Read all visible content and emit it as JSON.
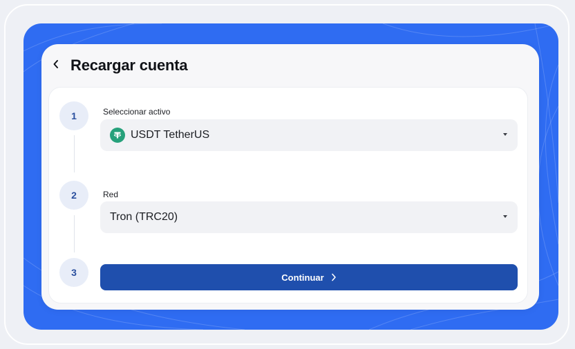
{
  "header": {
    "title": "Recargar cuenta",
    "back_icon": "chevron-left-icon"
  },
  "steps": [
    {
      "number": "1",
      "label": "Seleccionar activo",
      "value": "USDT TetherUS",
      "icon": "tether-icon"
    },
    {
      "number": "2",
      "label": "Red",
      "value": "Tron (TRC20)"
    },
    {
      "number": "3"
    }
  ],
  "actions": {
    "continue_label": "Continuar",
    "continue_icon": "chevron-right-icon"
  },
  "colors": {
    "accent_blue": "#2f6cf2",
    "button_blue": "#1f4fad",
    "tether_green": "#26a17b",
    "step_circle_bg": "#e8edf8"
  }
}
